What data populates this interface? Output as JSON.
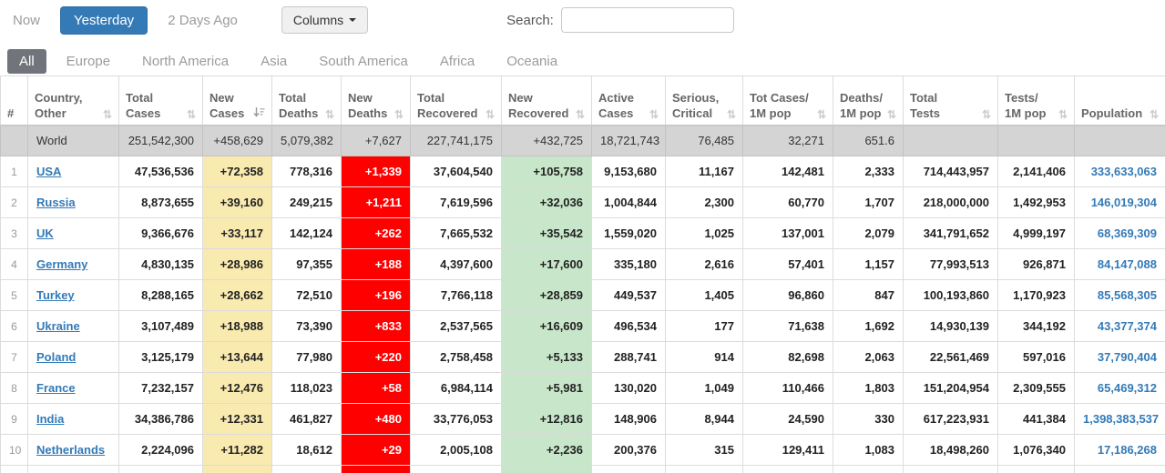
{
  "toolbar": {
    "now_label": "Now",
    "yesterday_label": "Yesterday",
    "two_days_ago_label": "2 Days Ago",
    "columns_label": "Columns",
    "search_label": "Search:",
    "search_value": "",
    "search_placeholder": ""
  },
  "colors": {
    "accent": "#337ab7",
    "new_cases_bg": "#FFEEAA",
    "new_deaths_bg": "#FF0000",
    "new_recovered_bg": "#C8E6C9",
    "active_tab_bg": "#71757B"
  },
  "tabs": [
    {
      "label": "All",
      "active": true
    },
    {
      "label": "Europe",
      "active": false
    },
    {
      "label": "North America",
      "active": false
    },
    {
      "label": "Asia",
      "active": false
    },
    {
      "label": "South America",
      "active": false
    },
    {
      "label": "Africa",
      "active": false
    },
    {
      "label": "Oceania",
      "active": false
    }
  ],
  "table": {
    "columns": [
      {
        "id": "rank",
        "lines": [
          "#"
        ],
        "sort": null
      },
      {
        "id": "country",
        "lines": [
          "Country,",
          "Other"
        ],
        "sort": "none"
      },
      {
        "id": "total_cases",
        "lines": [
          "Total",
          "Cases"
        ],
        "sort": "none"
      },
      {
        "id": "new_cases",
        "lines": [
          "New",
          "Cases"
        ],
        "sort": "desc"
      },
      {
        "id": "total_deaths",
        "lines": [
          "Total",
          "Deaths"
        ],
        "sort": "none"
      },
      {
        "id": "new_deaths",
        "lines": [
          "New",
          "Deaths"
        ],
        "sort": "none"
      },
      {
        "id": "total_recovered",
        "lines": [
          "Total",
          "Recovered"
        ],
        "sort": "none"
      },
      {
        "id": "new_recovered",
        "lines": [
          "New",
          "Recovered"
        ],
        "sort": "none"
      },
      {
        "id": "active_cases",
        "lines": [
          "Active",
          "Cases"
        ],
        "sort": "none"
      },
      {
        "id": "serious_critical",
        "lines": [
          "Serious,",
          "Critical"
        ],
        "sort": "none"
      },
      {
        "id": "tot_cases_1m",
        "lines": [
          "Tot Cases/",
          "1M pop"
        ],
        "sort": "none"
      },
      {
        "id": "deaths_1m",
        "lines": [
          "Deaths/",
          "1M pop"
        ],
        "sort": "none"
      },
      {
        "id": "total_tests",
        "lines": [
          "Total",
          "Tests"
        ],
        "sort": "none"
      },
      {
        "id": "tests_1m",
        "lines": [
          "Tests/",
          "1M pop"
        ],
        "sort": "none"
      },
      {
        "id": "population",
        "lines": [
          "Population"
        ],
        "sort": "none"
      }
    ],
    "world_row": {
      "rank": "",
      "country": "World",
      "total_cases": "251,542,300",
      "new_cases": "+458,629",
      "total_deaths": "5,079,382",
      "new_deaths": "+7,627",
      "total_recovered": "227,741,175",
      "new_recovered": "+432,725",
      "active_cases": "18,721,743",
      "serious_critical": "76,485",
      "tot_cases_1m": "32,271",
      "deaths_1m": "651.6",
      "total_tests": "",
      "tests_1m": "",
      "population": ""
    },
    "rows": [
      {
        "rank": "1",
        "country": "USA",
        "total_cases": "47,536,536",
        "new_cases": "+72,358",
        "total_deaths": "778,316",
        "new_deaths": "+1,339",
        "total_recovered": "37,604,540",
        "new_recovered": "+105,758",
        "active_cases": "9,153,680",
        "serious_critical": "11,167",
        "tot_cases_1m": "142,481",
        "deaths_1m": "2,333",
        "total_tests": "714,443,957",
        "tests_1m": "2,141,406",
        "population": "333,633,063"
      },
      {
        "rank": "2",
        "country": "Russia",
        "total_cases": "8,873,655",
        "new_cases": "+39,160",
        "total_deaths": "249,215",
        "new_deaths": "+1,211",
        "total_recovered": "7,619,596",
        "new_recovered": "+32,036",
        "active_cases": "1,004,844",
        "serious_critical": "2,300",
        "tot_cases_1m": "60,770",
        "deaths_1m": "1,707",
        "total_tests": "218,000,000",
        "tests_1m": "1,492,953",
        "population": "146,019,304"
      },
      {
        "rank": "3",
        "country": "UK",
        "total_cases": "9,366,676",
        "new_cases": "+33,117",
        "total_deaths": "142,124",
        "new_deaths": "+262",
        "total_recovered": "7,665,532",
        "new_recovered": "+35,542",
        "active_cases": "1,559,020",
        "serious_critical": "1,025",
        "tot_cases_1m": "137,001",
        "deaths_1m": "2,079",
        "total_tests": "341,791,652",
        "tests_1m": "4,999,197",
        "population": "68,369,309"
      },
      {
        "rank": "4",
        "country": "Germany",
        "total_cases": "4,830,135",
        "new_cases": "+28,986",
        "total_deaths": "97,355",
        "new_deaths": "+188",
        "total_recovered": "4,397,600",
        "new_recovered": "+17,600",
        "active_cases": "335,180",
        "serious_critical": "2,616",
        "tot_cases_1m": "57,401",
        "deaths_1m": "1,157",
        "total_tests": "77,993,513",
        "tests_1m": "926,871",
        "population": "84,147,088"
      },
      {
        "rank": "5",
        "country": "Turkey",
        "total_cases": "8,288,165",
        "new_cases": "+28,662",
        "total_deaths": "72,510",
        "new_deaths": "+196",
        "total_recovered": "7,766,118",
        "new_recovered": "+28,859",
        "active_cases": "449,537",
        "serious_critical": "1,405",
        "tot_cases_1m": "96,860",
        "deaths_1m": "847",
        "total_tests": "100,193,860",
        "tests_1m": "1,170,923",
        "population": "85,568,305"
      },
      {
        "rank": "6",
        "country": "Ukraine",
        "total_cases": "3,107,489",
        "new_cases": "+18,988",
        "total_deaths": "73,390",
        "new_deaths": "+833",
        "total_recovered": "2,537,565",
        "new_recovered": "+16,609",
        "active_cases": "496,534",
        "serious_critical": "177",
        "tot_cases_1m": "71,638",
        "deaths_1m": "1,692",
        "total_tests": "14,930,139",
        "tests_1m": "344,192",
        "population": "43,377,374"
      },
      {
        "rank": "7",
        "country": "Poland",
        "total_cases": "3,125,179",
        "new_cases": "+13,644",
        "total_deaths": "77,980",
        "new_deaths": "+220",
        "total_recovered": "2,758,458",
        "new_recovered": "+5,133",
        "active_cases": "288,741",
        "serious_critical": "914",
        "tot_cases_1m": "82,698",
        "deaths_1m": "2,063",
        "total_tests": "22,561,469",
        "tests_1m": "597,016",
        "population": "37,790,404"
      },
      {
        "rank": "8",
        "country": "France",
        "total_cases": "7,232,157",
        "new_cases": "+12,476",
        "total_deaths": "118,023",
        "new_deaths": "+58",
        "total_recovered": "6,984,114",
        "new_recovered": "+5,981",
        "active_cases": "130,020",
        "serious_critical": "1,049",
        "tot_cases_1m": "110,466",
        "deaths_1m": "1,803",
        "total_tests": "151,204,954",
        "tests_1m": "2,309,555",
        "population": "65,469,312"
      },
      {
        "rank": "9",
        "country": "India",
        "total_cases": "34,386,786",
        "new_cases": "+12,331",
        "total_deaths": "461,827",
        "new_deaths": "+480",
        "total_recovered": "33,776,053",
        "new_recovered": "+12,816",
        "active_cases": "148,906",
        "serious_critical": "8,944",
        "tot_cases_1m": "24,590",
        "deaths_1m": "330",
        "total_tests": "617,223,931",
        "tests_1m": "441,384",
        "population": "1,398,383,537"
      },
      {
        "rank": "10",
        "country": "Netherlands",
        "total_cases": "2,224,096",
        "new_cases": "+11,282",
        "total_deaths": "18,612",
        "new_deaths": "+29",
        "total_recovered": "2,005,108",
        "new_recovered": "+2,236",
        "active_cases": "200,376",
        "serious_critical": "315",
        "tot_cases_1m": "129,411",
        "deaths_1m": "1,083",
        "total_tests": "18,498,260",
        "tests_1m": "1,076,340",
        "population": "17,186,268"
      }
    ]
  }
}
